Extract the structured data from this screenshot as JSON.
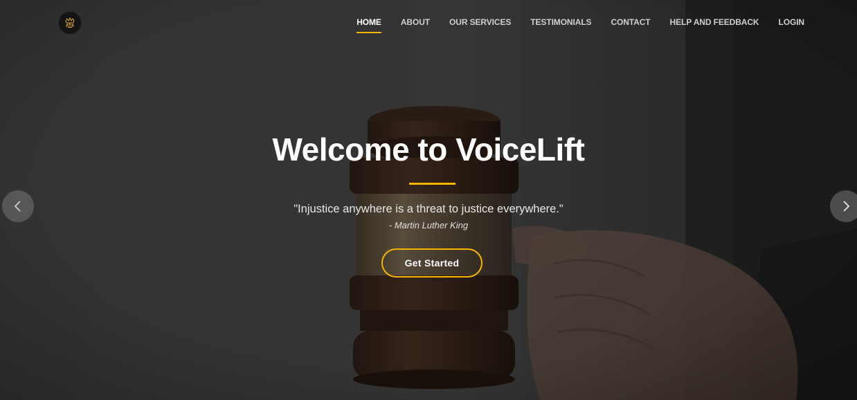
{
  "header": {
    "logo_icon": "crown-scales-logo-icon",
    "nav": [
      {
        "label": "HOME",
        "active": true
      },
      {
        "label": "ABOUT",
        "active": false
      },
      {
        "label": "OUR SERVICES",
        "active": false
      },
      {
        "label": "TESTIMONIALS",
        "active": false
      },
      {
        "label": "CONTACT",
        "active": false
      },
      {
        "label": "HELP AND FEEDBACK",
        "active": false
      },
      {
        "label": "LOGIN",
        "active": false
      }
    ]
  },
  "hero": {
    "title": "Welcome to VoiceLift",
    "quote": "\"Injustice anywhere is a threat to justice everywhere.\"",
    "author": "- Martin Luther King",
    "cta_label": "Get Started",
    "background_image": "judge-gavel-in-hand",
    "prev_icon": "chevron-left-icon",
    "next_icon": "chevron-right-icon"
  },
  "colors": {
    "accent": "#f5b400",
    "text": "#ffffff",
    "overlay": "#3c3c3c"
  }
}
